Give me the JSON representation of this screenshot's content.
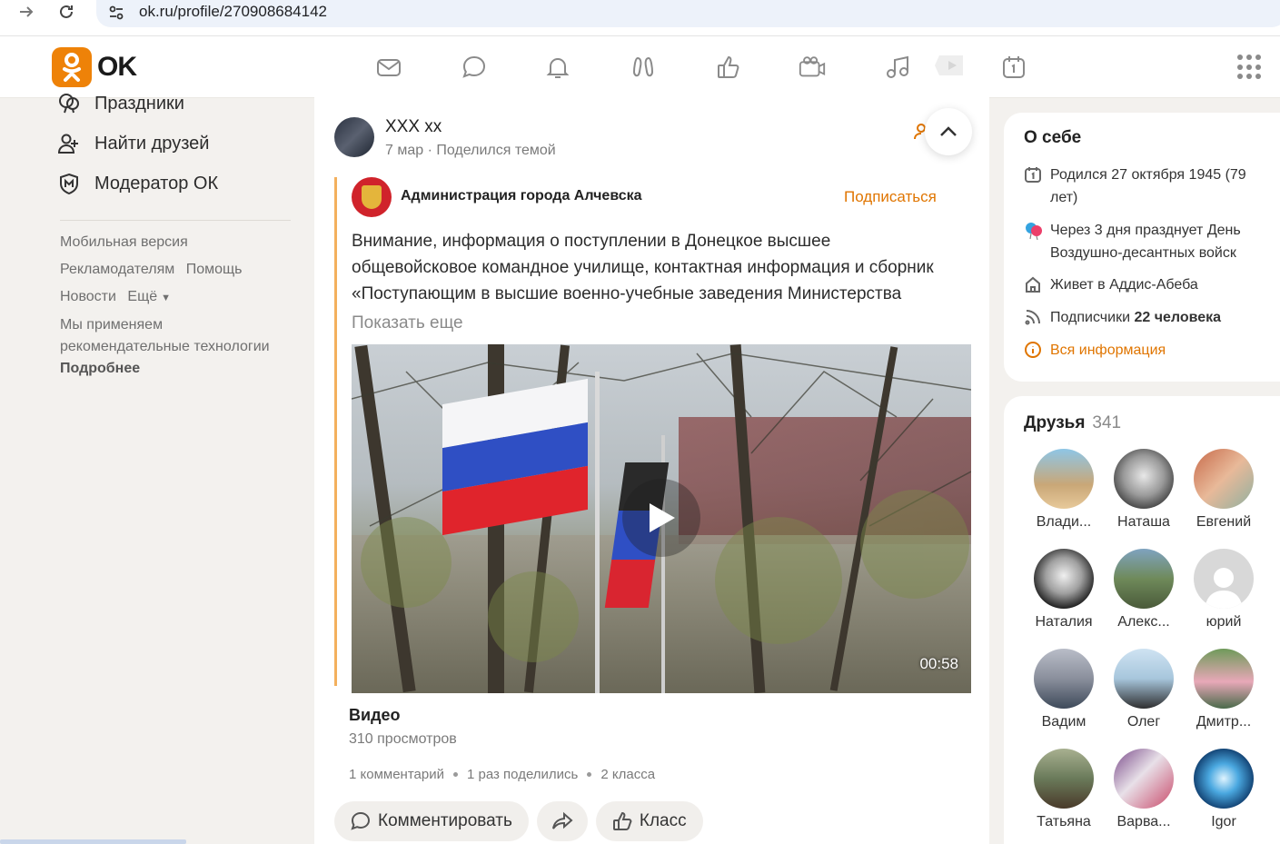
{
  "browser": {
    "url": "ok.ru/profile/270908684142"
  },
  "header": {
    "logo_text": "OK",
    "icons": [
      "messages-icon",
      "discussions-icon",
      "notifications-icon",
      "guests-icon",
      "reactions-icon",
      "photos-icon",
      "music-icon",
      "video-icon",
      "calendar-icon",
      "apps-grid-icon"
    ]
  },
  "left_menu": {
    "items": [
      {
        "label": "Праздники",
        "icon": "balloons-icon"
      },
      {
        "label": "Найти друзей",
        "icon": "add-friend-icon"
      },
      {
        "label": "Модератор ОК",
        "icon": "moderator-shield-icon"
      }
    ],
    "footer": {
      "mobile": "Мобильная версия",
      "advertisers": "Рекламодателям",
      "help": "Помощь",
      "news": "Новости",
      "more": "Ещё",
      "recommend_line1": "Мы применяем",
      "recommend_line2": "рекомендательные технологии",
      "details": "Подробнее"
    }
  },
  "post": {
    "author": "XXX xx",
    "date": "7 мар",
    "separator": "·",
    "action": "Поделился темой",
    "group": {
      "name": "Администрация города Алчевска",
      "subscribe": "Подписаться"
    },
    "text_lines": [
      "Внимание, информация о поступлении в Донецкое высшее",
      "общевойсковое командное училище, контактная информация и сборник",
      "«Поступающим в высшие военно-учебные заведения Министерства"
    ],
    "show_more": "Показать еще",
    "video": {
      "duration": "00:58",
      "title": "Видео",
      "views": "310 просмотров"
    },
    "stats": {
      "comments": "1 комментарий",
      "shares": "1 раз поделились",
      "likes": "2 класса"
    },
    "actions": {
      "comment": "Комментировать",
      "like": "Класс"
    }
  },
  "about": {
    "title": "О себе",
    "born": "Родился 27 октября 1945 (79 лет)",
    "holiday": "Через 3 дня празднует День Воздушно-десантных войск",
    "lives": "Живет в Аддис-Абеба",
    "followers_prefix": "Подписчики",
    "followers_count": "22 человека",
    "all_info": "Вся информация"
  },
  "friends": {
    "title": "Друзья",
    "count": "341",
    "list": [
      {
        "name": "Влади..."
      },
      {
        "name": "Наташа"
      },
      {
        "name": "Евгений"
      },
      {
        "name": "Наталия"
      },
      {
        "name": "Алекс..."
      },
      {
        "name": "юрий"
      },
      {
        "name": "Вадим"
      },
      {
        "name": "Олег"
      },
      {
        "name": "Дмитр..."
      },
      {
        "name": "Татьяна"
      },
      {
        "name": "Варва..."
      },
      {
        "name": "Igor"
      }
    ]
  },
  "colors": {
    "brand_orange": "#ee8208",
    "link_orange": "#e07500",
    "share_border": "#f3b05d"
  }
}
